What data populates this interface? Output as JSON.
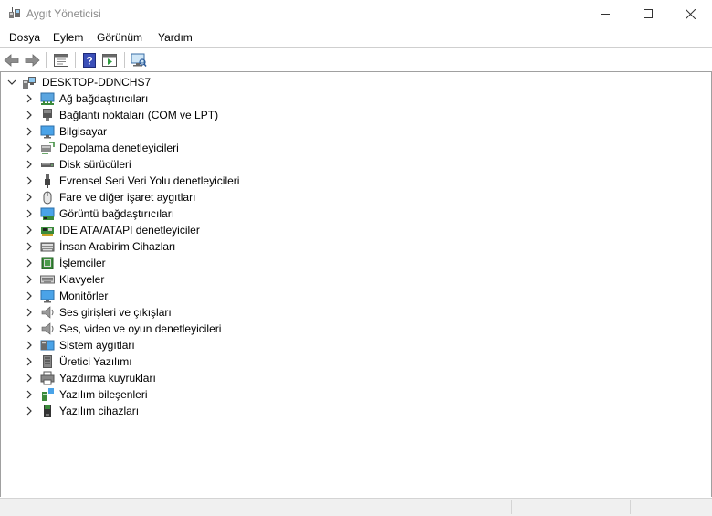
{
  "window": {
    "title": "Aygıt Yöneticisi",
    "controls": {
      "minimize": "minimize-icon",
      "maximize": "maximize-icon",
      "close": "close-icon"
    }
  },
  "menu": [
    "Dosya",
    "Eylem",
    "Görünüm",
    "Yardım"
  ],
  "toolbar": [
    "back-arrow-icon",
    "forward-arrow-icon",
    "properties-icon",
    "help-icon",
    "run-icon",
    "computer-scan-icon"
  ],
  "tree": {
    "root": {
      "label": "DESKTOP-DDNCHS7",
      "icon": "computer-icon",
      "expanded": true
    },
    "items": [
      {
        "label": "Ağ bağdaştırıcıları",
        "icon": "network-adapter-icon"
      },
      {
        "label": "Bağlantı noktaları (COM ve LPT)",
        "icon": "port-icon"
      },
      {
        "label": "Bilgisayar",
        "icon": "monitor-icon"
      },
      {
        "label": "Depolama denetleyicileri",
        "icon": "storage-controller-icon"
      },
      {
        "label": "Disk sürücüleri",
        "icon": "disk-drive-icon"
      },
      {
        "label": "Evrensel Seri Veri Yolu denetleyicileri",
        "icon": "usb-icon"
      },
      {
        "label": "Fare ve diğer işaret aygıtları",
        "icon": "mouse-icon"
      },
      {
        "label": "Görüntü bağdaştırıcıları",
        "icon": "display-adapter-icon"
      },
      {
        "label": "IDE ATA/ATAPI denetleyiciler",
        "icon": "ide-controller-icon"
      },
      {
        "label": "İnsan Arabirim Cihazları",
        "icon": "hid-icon"
      },
      {
        "label": "İşlemciler",
        "icon": "processor-icon"
      },
      {
        "label": "Klavyeler",
        "icon": "keyboard-icon"
      },
      {
        "label": "Monitörler",
        "icon": "monitor-icon"
      },
      {
        "label": "Ses girişleri ve çıkışları",
        "icon": "speaker-icon"
      },
      {
        "label": "Ses, video ve oyun denetleyicileri",
        "icon": "speaker-icon"
      },
      {
        "label": "Sistem aygıtları",
        "icon": "system-device-icon"
      },
      {
        "label": "Üretici Yazılımı",
        "icon": "firmware-icon"
      },
      {
        "label": "Yazdırma kuyrukları",
        "icon": "printer-icon"
      },
      {
        "label": "Yazılım bileşenleri",
        "icon": "software-component-icon"
      },
      {
        "label": "Yazılım cihazları",
        "icon": "software-device-icon"
      }
    ]
  }
}
